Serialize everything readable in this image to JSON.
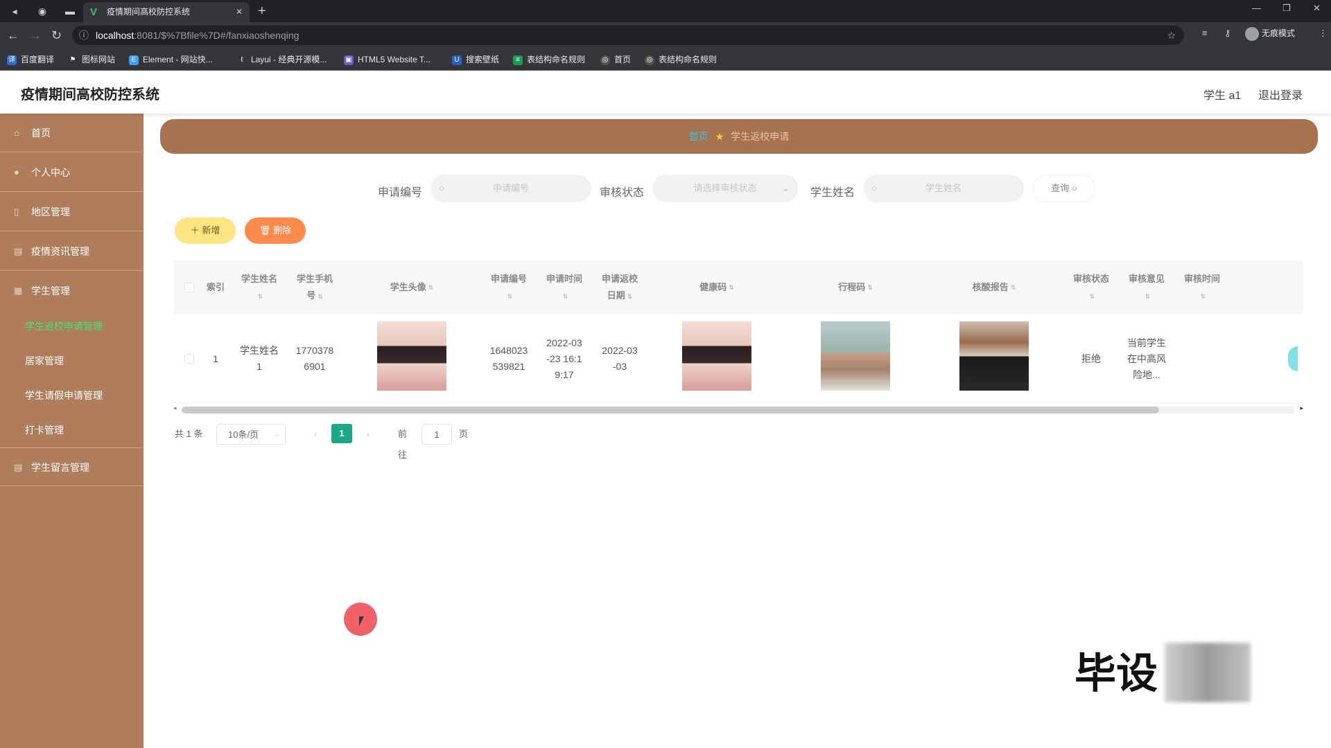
{
  "browser": {
    "tab_title": "疫情期间高校防控系统",
    "url_host": "localhost",
    "url_path": ":8081/$%7Bfile%7D#/fanxiaoshenqing",
    "incognito_label": "无痕模式",
    "bookmarks": [
      "百度翻译",
      "图标网站",
      "Element - 网站快...",
      "Layui - 经典开源模...",
      "HTML5 Website T...",
      "搜索壁纸",
      "表结构命名规则",
      "首页",
      "表结构命名规则"
    ]
  },
  "header": {
    "title": "疫情期间高校防控系统",
    "user": "学生 a1",
    "logout": "退出登录"
  },
  "sidebar": {
    "items": [
      "首页",
      "个人中心",
      "地区管理",
      "疫情资讯管理",
      "学生管理"
    ],
    "sub_items": [
      "学生返校申请管理",
      "居家管理",
      "学生请假申请管理",
      "打卡管理"
    ],
    "bottom_item": "学生留言管理"
  },
  "breadcrumb": {
    "home": "首页",
    "current": "学生返校申请"
  },
  "search": {
    "label1": "申请编号",
    "placeholder1": "申请编号",
    "label2": "审核状态",
    "placeholder2": "请选择审核状态",
    "label3": "学生姓名",
    "placeholder3": "学生姓名",
    "query": "查询"
  },
  "actions": {
    "add": "新增",
    "delete": "删除"
  },
  "table": {
    "headers": {
      "index": "索引",
      "name": "学生姓名",
      "phone_l1": "学生手机",
      "phone_l2": "号",
      "avatar": "学生头像",
      "apply_no": "申请编号",
      "apply_time": "申请时间",
      "return_l1": "申请返校",
      "return_l2": "日期",
      "health": "健康码",
      "trip": "行程码",
      "nat": "核酸报告",
      "status": "审核状态",
      "opinion": "审核意见",
      "review_time": "审核时间"
    },
    "rows": [
      {
        "index": "1",
        "name_l1": "学生姓名",
        "name_l2": "1",
        "phone_l1": "1770378",
        "phone_l2": "6901",
        "apply_l1": "1648023",
        "apply_l2": "539821",
        "time_l1": "2022-03",
        "time_l2": "-23 16:1",
        "time_l3": "9:17",
        "return_l1": "2022-03",
        "return_l2": "-03",
        "status": "拒绝",
        "opinion_l1": "当前学生",
        "opinion_l2": "在中高风",
        "opinion_l3": "险地..."
      }
    ]
  },
  "pagination": {
    "total": "共 1 条",
    "page_size": "10条/页",
    "current": "1",
    "goto": "前往",
    "goto_value": "1",
    "page_unit": "页"
  },
  "overlay": {
    "watermark": "毕设"
  }
}
